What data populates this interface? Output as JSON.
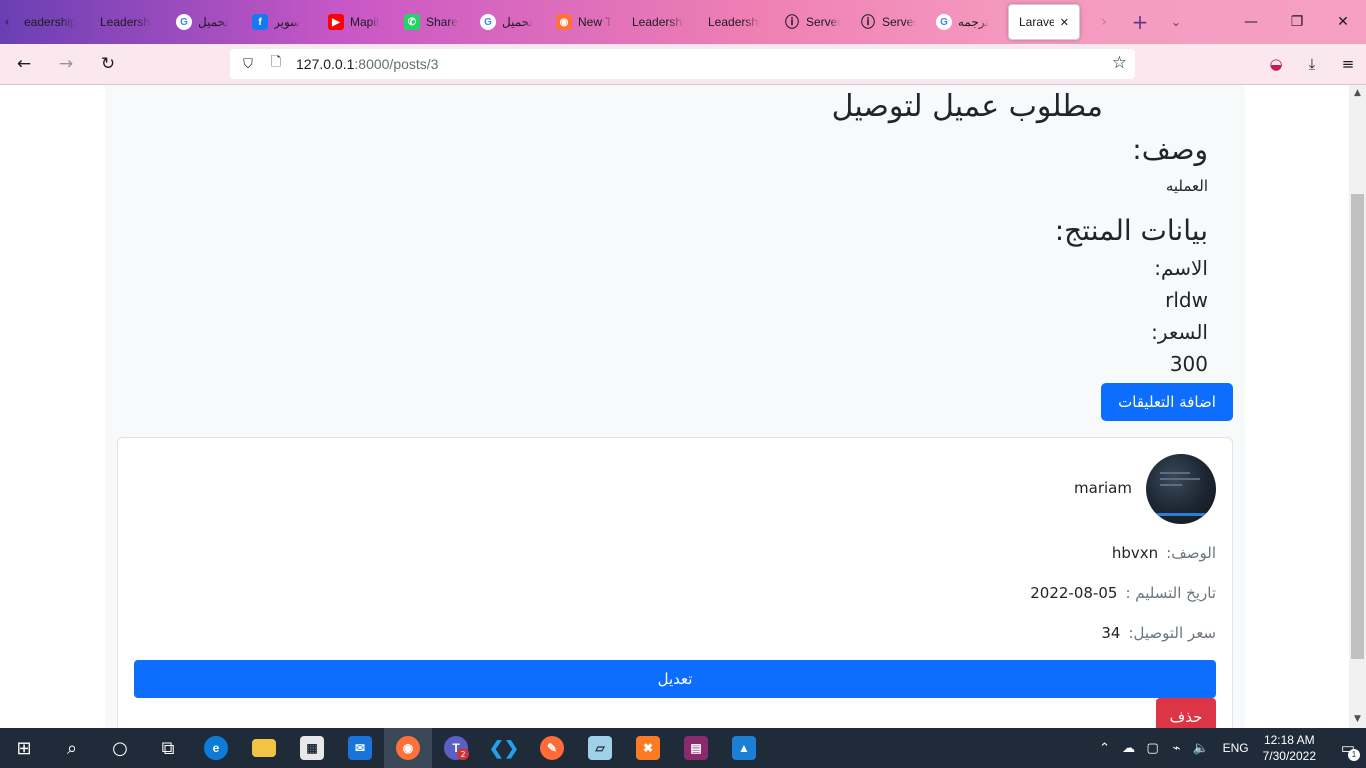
{
  "browser": {
    "tabs": [
      {
        "label": "eadership",
        "icon": "generic-page-icon",
        "color": ""
      },
      {
        "label": "Leadership",
        "icon": "generic-page-icon",
        "color": ""
      },
      {
        "label": "تحميل",
        "icon": "google-icon",
        "color": "#4285f4"
      },
      {
        "label": "سوير",
        "icon": "facebook-icon",
        "color": "#1877f2"
      },
      {
        "label": "Mapit",
        "icon": "youtube-icon",
        "color": "#ff0000"
      },
      {
        "label": "Share",
        "icon": "whatsapp-icon",
        "color": "#25d366"
      },
      {
        "label": "تحميل",
        "icon": "google-icon",
        "color": "#4285f4"
      },
      {
        "label": "New T",
        "icon": "firefox-icon",
        "color": "#ff7139"
      },
      {
        "label": "Leadership",
        "icon": "generic-page-icon",
        "color": ""
      },
      {
        "label": "Leadership",
        "icon": "generic-page-icon",
        "color": ""
      },
      {
        "label": "Server",
        "icon": "info-icon",
        "color": ""
      },
      {
        "label": "Server",
        "icon": "info-icon",
        "color": ""
      },
      {
        "label": "ترجمه",
        "icon": "google-icon",
        "color": "#4285f4"
      }
    ],
    "active_tab": {
      "label": "Laravel",
      "close": "✕"
    },
    "url_host": "127.0.0.1",
    "url_path": ":8000/posts/3"
  },
  "post": {
    "title": "مطلوب عميل لتوصيل",
    "description_heading": "وصف:",
    "description": "العمليه",
    "product_heading": "بيانات المنتج:",
    "name_label": "الاسم:",
    "name_value": "rldw",
    "price_label": "السعر:",
    "price_value": "300",
    "add_comments_button": "اضافة التعليقات"
  },
  "comment": {
    "username": "mariam",
    "desc_label": "الوصف:",
    "desc_value": "hbvxn",
    "delivery_date_label": "تاريخ التسليم :",
    "delivery_date_value": "2022-08-05",
    "delivery_price_label": "سعر التوصيل:",
    "delivery_price_value": "34",
    "edit_button": "تعديل",
    "delete_button": "حذف"
  },
  "taskbar": {
    "language": "ENG",
    "time": "12:18 AM",
    "date": "7/30/2022",
    "notification_count": "1",
    "teams_badge": "2"
  },
  "colors": {
    "primary": "#0d6efd",
    "danger": "#dc3545",
    "panel_bg": "#f8f9fa",
    "taskbar_bg": "#1f2b39"
  }
}
